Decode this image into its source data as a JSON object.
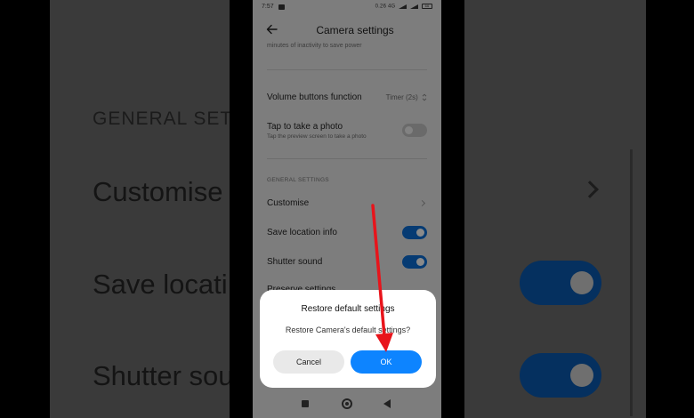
{
  "status_bar": {
    "time": "7:57",
    "icons_text": "0.26 4G",
    "battery": "66"
  },
  "header": {
    "title": "Camera settings"
  },
  "settings": {
    "inactivity_subtitle": "minutes of inactivity to save power",
    "volume_buttons": {
      "label": "Volume buttons function",
      "value": "Timer (2s)"
    },
    "tap_photo": {
      "label": "Tap to take a photo",
      "subtitle": "Tap the preview screen to take a photo",
      "enabled": false
    },
    "general_section": "GENERAL SETTINGS",
    "customise": {
      "label": "Customise"
    },
    "save_location": {
      "label": "Save location info",
      "enabled": true
    },
    "shutter_sound": {
      "label": "Shutter sound",
      "enabled": true
    },
    "preserve_settings": {
      "label": "Preserve settings"
    }
  },
  "dialog": {
    "title": "Restore default settings",
    "message": "Restore Camera's default settings?",
    "cancel_label": "Cancel",
    "ok_label": "OK"
  },
  "background": {
    "heading": "GENERAL SETT",
    "customise": "Customise",
    "save_location": "Save locati",
    "shutter_sound": "Shutter sou"
  },
  "colors": {
    "accent": "#0d84ff",
    "toggle_on": "#063b73",
    "arrow": "#e8141b"
  },
  "icons": {
    "back": "arrow-left-icon",
    "updown": "chevron-updown-icon",
    "chevron": "chevron-right-icon"
  }
}
